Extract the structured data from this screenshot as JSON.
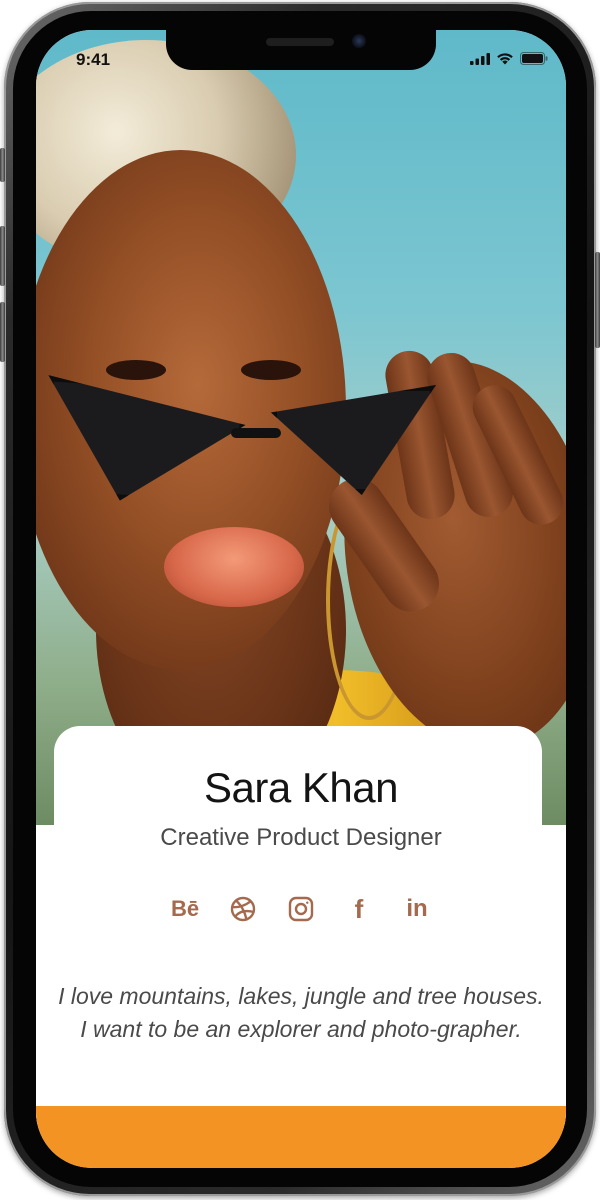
{
  "status_bar": {
    "time": "9:41"
  },
  "profile": {
    "name": "Sara Khan",
    "role": "Creative Product Designer",
    "bio": "I love mountains, lakes, jungle and tree houses. I want to be an explorer and photo-grapher."
  },
  "socials": [
    {
      "icon": "behance-icon",
      "label": "Bē"
    },
    {
      "icon": "dribbble-icon"
    },
    {
      "icon": "instagram-icon"
    },
    {
      "icon": "facebook-icon",
      "label": "f"
    },
    {
      "icon": "linkedin-icon",
      "label": "in"
    }
  ],
  "colors": {
    "accent": "#F39324",
    "social_icon": "#A56A4E",
    "name_text": "#141414",
    "body_text": "#4A4A4A"
  }
}
